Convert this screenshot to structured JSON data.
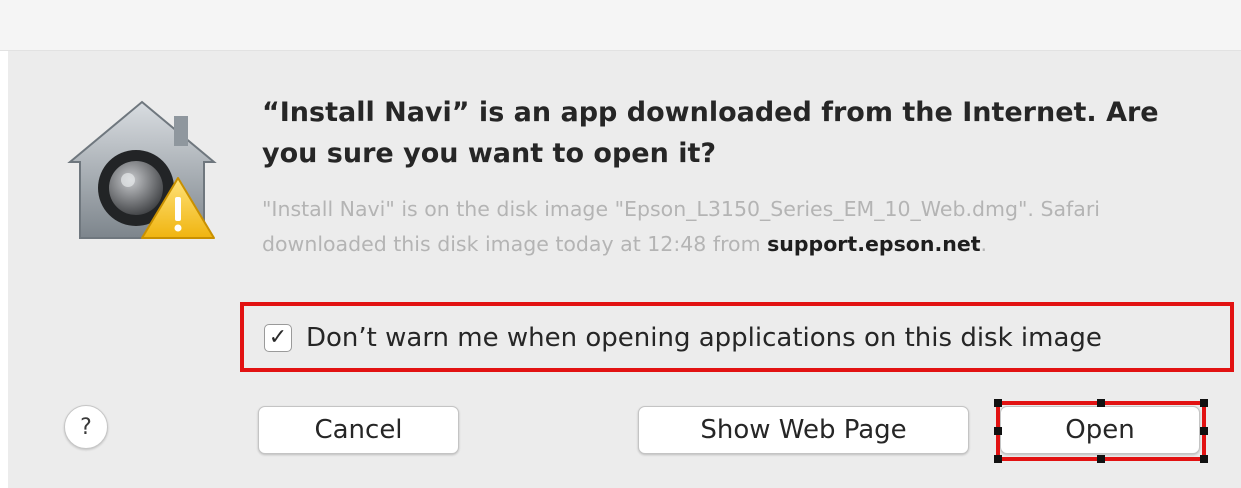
{
  "dialog": {
    "title": "“Install Navi” is an app downloaded from the Internet. Are you sure you want to open it?",
    "message": {
      "text_before": "\"Install Navi\" is on the disk image \"Epson_L3150_Series_EM_10_Web.dmg\". Safari downloaded this disk image today at 12:48 from ",
      "source": "support.epson.net",
      "text_after": "."
    },
    "checkbox": {
      "checked": true,
      "mark": "✓",
      "label": "Don’t warn me when opening applications on this disk image"
    },
    "buttons": {
      "help": "?",
      "cancel": "Cancel",
      "show_web_page": "Show Web Page",
      "open": "Open"
    }
  },
  "icons": {
    "app_icon": "gatekeeper-warning-icon",
    "check": "checkmark-icon"
  },
  "colors": {
    "dialog_background": "#ececec",
    "highlight": "#e21212",
    "warning": "#f6c21c",
    "secondary_text": "#b4b4b4"
  }
}
